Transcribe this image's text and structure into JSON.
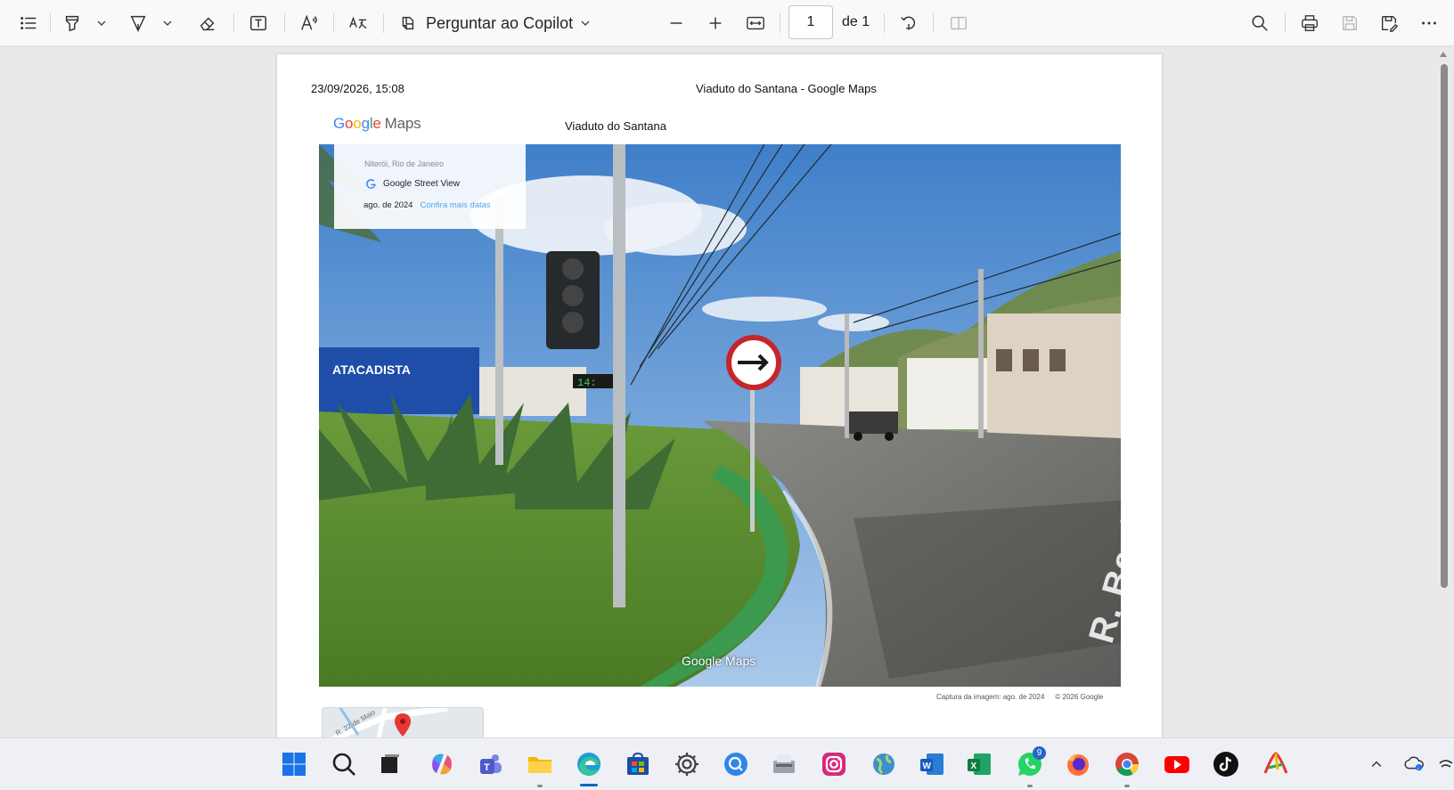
{
  "toolbar": {
    "copilot_label": "Perguntar ao Copilot",
    "page_current": "1",
    "page_of": "de 1"
  },
  "document": {
    "header_date": "23/09/2026, 15:08",
    "header_title": "Viaduto do Santana - Google Maps",
    "logo_google": "Google",
    "logo_maps": "Maps",
    "place_name": "Viaduto do Santana",
    "streetview": {
      "location": "Niterói, Rio de Janeiro",
      "brand": "Google Street View",
      "date": "ago. de 2024",
      "more_dates": "Confira mais datas"
    },
    "photo_watermark": "Google Maps",
    "street_sign_text": "R. Benjamin",
    "caption_capture": "Captura da imagem: ago. de 2024",
    "caption_copyright": "© 2026 Google",
    "minimap_label": "R. 22 de Maio"
  },
  "taskbar": {
    "whatsapp_badge": "9"
  },
  "colors": {
    "accent": "#0067c0",
    "page_bg": "#e9e9eb",
    "toolbar_bg": "#f9f9f9"
  }
}
